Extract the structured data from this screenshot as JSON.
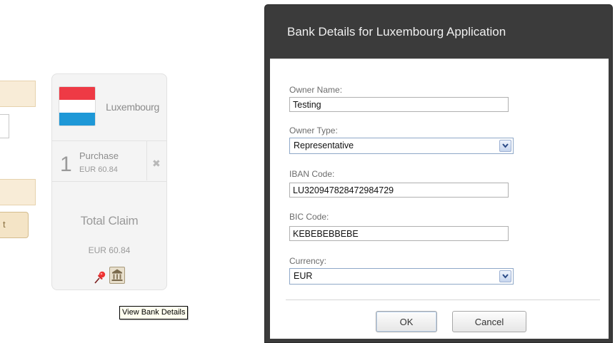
{
  "background": {
    "fragment_button_label": "t"
  },
  "card": {
    "country": "Luxembourg",
    "item": {
      "quantity": "1",
      "title": "Purchase",
      "price": "EUR 60.84",
      "remove_icon": "close-icon"
    },
    "total": {
      "label": "Total Claim",
      "value": "EUR 60.84"
    },
    "icons": {
      "pin": "pushpin-icon",
      "bank": "bank-icon"
    },
    "tooltip": "View Bank Details"
  },
  "dialog": {
    "title": "Bank Details for Luxembourg Application",
    "fields": {
      "owner_name": {
        "label": "Owner Name:",
        "value": "Testing"
      },
      "owner_type": {
        "label": "Owner Type:",
        "value": "Representative"
      },
      "iban": {
        "label": "IBAN Code:",
        "value": "LU320947828472984729"
      },
      "bic": {
        "label": "BIC Code:",
        "value": "KEBEBEBBEBE"
      },
      "currency": {
        "label": "Currency:",
        "value": "EUR"
      }
    },
    "buttons": {
      "ok": "OK",
      "cancel": "Cancel"
    }
  },
  "colors": {
    "dialog_header": "#3b3b3b",
    "flag_red": "#ee3a45",
    "flag_blue": "#1e98d7",
    "accent_beige": "#f8ecd7"
  }
}
